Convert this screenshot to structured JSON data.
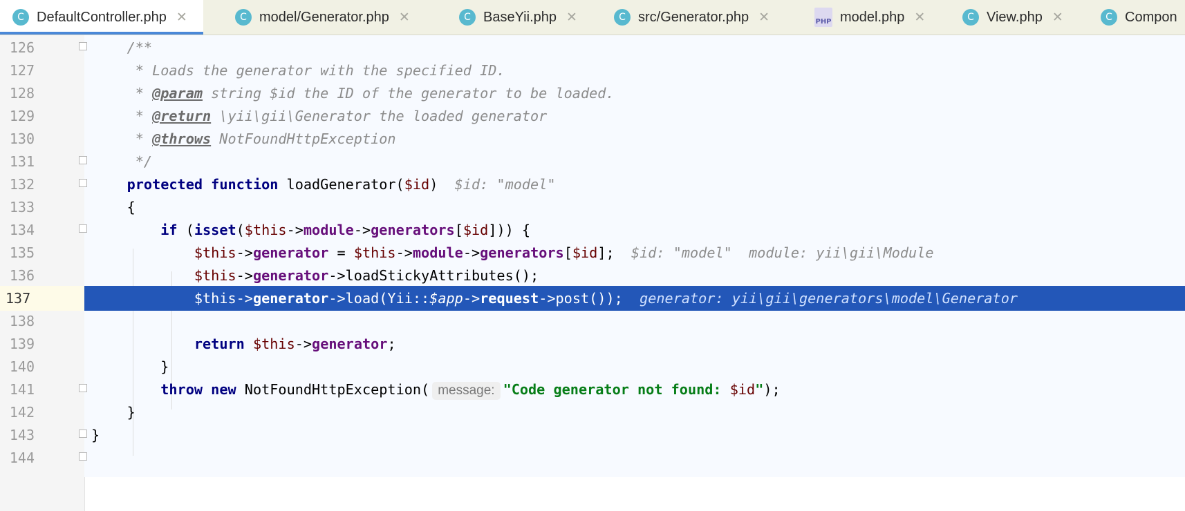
{
  "tabs": [
    {
      "label": "DefaultController.php",
      "icon": "class-icon",
      "icon_text": "C",
      "active": true
    },
    {
      "label": "model/Generator.php",
      "icon": "class-icon",
      "icon_text": "C"
    },
    {
      "label": "BaseYii.php",
      "icon": "class-icon",
      "icon_text": "C"
    },
    {
      "label": "src/Generator.php",
      "icon": "class-icon",
      "icon_text": "C"
    },
    {
      "label": "model.php",
      "icon": "php-file-icon",
      "icon_text": "PHP"
    },
    {
      "label": "View.php",
      "icon": "class-icon",
      "icon_text": "C"
    },
    {
      "label": "Compon",
      "icon": "class-icon",
      "icon_text": "C"
    }
  ],
  "close_glyph": "✕",
  "editor": {
    "lines": [
      {
        "num": "126",
        "t": {
          "a": "    /**"
        }
      },
      {
        "num": "127",
        "t": {
          "a": "     * Loads the generator with the specified ID."
        }
      },
      {
        "num": "128",
        "t": {
          "a": "     * ",
          "tag": "@param",
          "b": " string $id the ID of the generator to be loaded."
        }
      },
      {
        "num": "129",
        "t": {
          "a": "     * ",
          "tag": "@return",
          "b": " \\yii\\gii\\Generator the loaded generator"
        }
      },
      {
        "num": "130",
        "t": {
          "a": "     * ",
          "tag": "@throws",
          "b": " NotFoundHttpException"
        }
      },
      {
        "num": "131",
        "t": {
          "a": "     */"
        }
      },
      {
        "num": "132",
        "t": {
          "kw1": "protected",
          "kw2": "function",
          "fn": " loadGenerator(",
          "v": "$id",
          "close": ")",
          "inl": "$id: \"model\""
        }
      },
      {
        "num": "133",
        "t": {
          "a": "    {"
        }
      },
      {
        "num": "134",
        "t": {
          "kw": "if",
          "p1": " (",
          "fn": "isset",
          "p2": "(",
          "v1": "$this",
          "ar1": "->",
          "f1": "module",
          "ar2": "->",
          "f2": "generators",
          "p3": "[",
          "v2": "$id",
          "p4": "])) {"
        }
      },
      {
        "num": "135",
        "t": {
          "v1": "$this",
          "ar1": "->",
          "f1": "generator",
          "eq": " = ",
          "v2": "$this",
          "ar2": "->",
          "f2": "module",
          "ar3": "->",
          "f3": "generators",
          "p1": "[",
          "v3": "$id",
          "p2": "];",
          "inl1": "$id: \"model\"",
          "inl2": "module: yii\\gii\\Module"
        }
      },
      {
        "num": "136",
        "t": {
          "v1": "$this",
          "ar1": "->",
          "f1": "generator",
          "rest": "->loadStickyAttributes();"
        }
      },
      {
        "num": "137",
        "t": {
          "v1": "$this",
          "ar1": "->",
          "f1": "generator",
          "ar2": "->load(Yii::",
          "app": "$app",
          "ar3": "->",
          "f2": "request",
          "rest": "->post());",
          "inl": "generator: yii\\gii\\generators\\model\\Generator"
        }
      },
      {
        "num": "138",
        "t": {
          "a": ""
        }
      },
      {
        "num": "139",
        "t": {
          "kw": "return",
          "v1": " $this",
          "ar1": "->",
          "f1": "generator",
          "rest": ";"
        }
      },
      {
        "num": "140",
        "t": {
          "a": "        }"
        }
      },
      {
        "num": "141",
        "t": {
          "kw1": "throw",
          "kw2": "new",
          "fn": " NotFoundHttpException(",
          "hint": "message:",
          "str1": "\"Code generator not found: ",
          "v": "$id",
          "str2": "\"",
          "rest": ");"
        }
      },
      {
        "num": "142",
        "t": {
          "a": "    }"
        }
      },
      {
        "num": "143",
        "t": {
          "a": "}"
        }
      },
      {
        "num": "144",
        "t": {
          "a": ""
        }
      }
    ]
  }
}
